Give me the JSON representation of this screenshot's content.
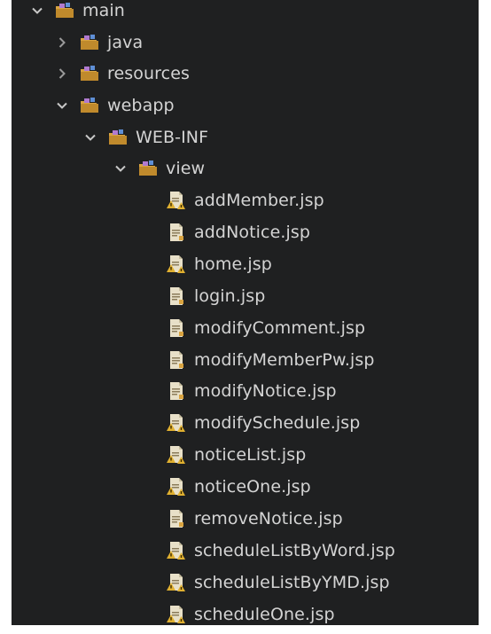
{
  "tree": {
    "folders": [
      {
        "label": "main",
        "state": "expanded",
        "icon": "package-folder-icon"
      },
      {
        "label": "java",
        "state": "collapsed",
        "icon": "package-folder-icon"
      },
      {
        "label": "resources",
        "state": "collapsed",
        "icon": "package-folder-icon"
      },
      {
        "label": "webapp",
        "state": "expanded",
        "icon": "package-folder-icon"
      },
      {
        "label": "WEB-INF",
        "state": "expanded",
        "icon": "package-folder-icon"
      },
      {
        "label": "view",
        "state": "expanded",
        "icon": "package-folder-icon"
      }
    ],
    "files": [
      {
        "label": "addMember.jsp",
        "icon": "jsp-file-warning-icon"
      },
      {
        "label": "addNotice.jsp",
        "icon": "jsp-file-icon"
      },
      {
        "label": "home.jsp",
        "icon": "jsp-file-warning-icon"
      },
      {
        "label": "login.jsp",
        "icon": "jsp-file-icon"
      },
      {
        "label": "modifyComment.jsp",
        "icon": "jsp-file-icon"
      },
      {
        "label": "modifyMemberPw.jsp",
        "icon": "jsp-file-icon"
      },
      {
        "label": "modifyNotice.jsp",
        "icon": "jsp-file-icon"
      },
      {
        "label": "modifySchedule.jsp",
        "icon": "jsp-file-warning-icon"
      },
      {
        "label": "noticeList.jsp",
        "icon": "jsp-file-warning-icon"
      },
      {
        "label": "noticeOne.jsp",
        "icon": "jsp-file-warning-icon"
      },
      {
        "label": "removeNotice.jsp",
        "icon": "jsp-file-icon"
      },
      {
        "label": "scheduleListByWord.jsp",
        "icon": "jsp-file-warning-icon"
      },
      {
        "label": "scheduleListByYMD.jsp",
        "icon": "jsp-file-warning-icon"
      },
      {
        "label": "scheduleOne.jsp",
        "icon": "jsp-file-warning-icon"
      }
    ]
  },
  "colors": {
    "background": "#1f2021",
    "text": "#d4d4d4",
    "chevron": "#c8c8c8",
    "folder": "#d9a441",
    "file": "#e8e0c8",
    "warning": "#e0b030"
  }
}
